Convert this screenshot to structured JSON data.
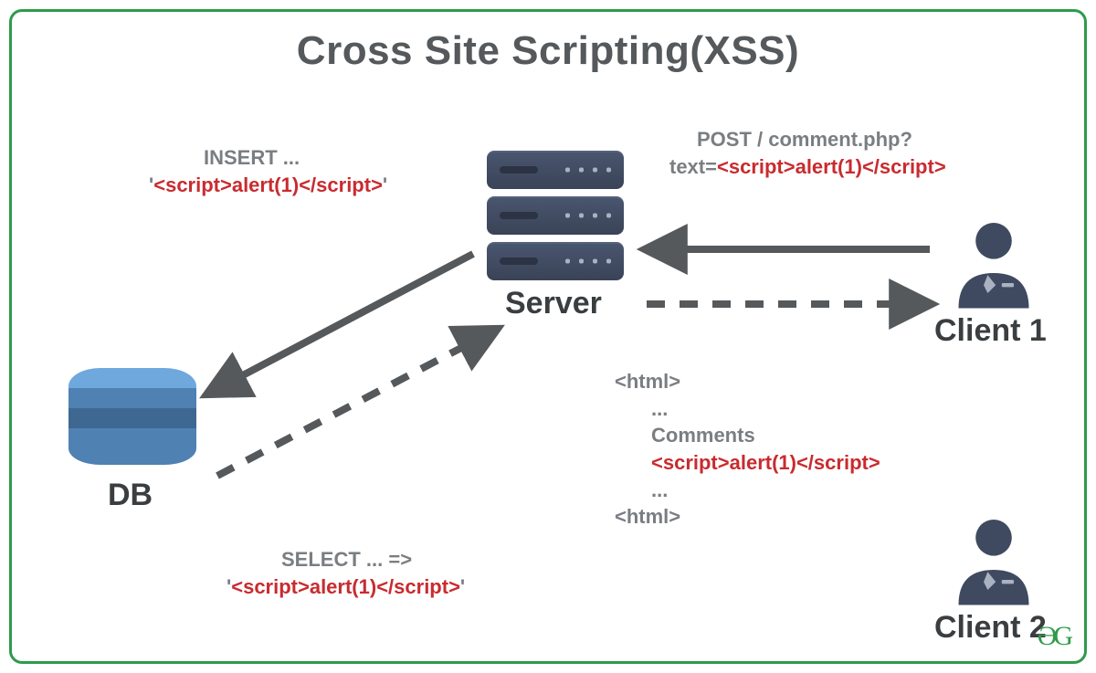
{
  "title": "Cross Site Scripting(XSS)",
  "nodes": {
    "server": "Server",
    "db": "DB",
    "client1": "Client 1",
    "client2": "Client 2"
  },
  "annotations": {
    "insert": {
      "line1": "INSERT ...",
      "prefix": "'",
      "script": "<script>alert(1)</script>",
      "suffix": "'"
    },
    "select": {
      "line1": "SELECT ... =>",
      "prefix": "'",
      "script": "<script>alert(1)</script>",
      "suffix": "'"
    },
    "post": {
      "line1": "POST / comment.php?",
      "prefix": "text=",
      "script": "<script>alert(1)</script>"
    },
    "response": {
      "open": "<html>",
      "dots1": "...",
      "comments": "Comments",
      "script": "<script>alert(1)</script>",
      "dots2": "...",
      "close": "<html>"
    }
  },
  "logo": "ƏG",
  "colors": {
    "border": "#2e9b4a",
    "text": "#55595c",
    "red": "#c92b2f",
    "server": "#3f4a60",
    "client": "#3f4a60"
  }
}
